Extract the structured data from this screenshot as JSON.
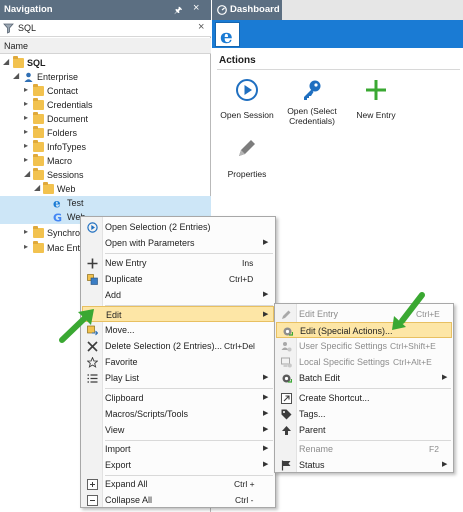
{
  "navigation": {
    "title": "Navigation",
    "search_value": "SQL",
    "column_header": "Name",
    "tree": [
      {
        "label": "SQL",
        "bold": true
      },
      {
        "label": "Enterprise"
      },
      {
        "label": "Contact"
      },
      {
        "label": "Credentials"
      },
      {
        "label": "Document"
      },
      {
        "label": "Folders"
      },
      {
        "label": "InfoTypes"
      },
      {
        "label": "Macro"
      },
      {
        "label": "Sessions"
      },
      {
        "label": "Web"
      },
      {
        "label": "Test"
      },
      {
        "label": "Web"
      },
      {
        "label": "Synchroni"
      },
      {
        "label": "Mac Entrie"
      }
    ]
  },
  "dashboard": {
    "tab_label": "Dashboard",
    "actions_title": "Actions",
    "actions": [
      {
        "label": "Open Session",
        "icon": "play-circle-icon"
      },
      {
        "label": "Open (Select\nCredentials)",
        "icon": "key-icon"
      },
      {
        "label": "New Entry",
        "icon": "plus-icon"
      },
      {
        "label": "Properties",
        "icon": "pencil-icon"
      }
    ]
  },
  "context_menu": {
    "items": [
      {
        "label": "Open Selection (2 Entries)",
        "icon": "play-circle-icon"
      },
      {
        "label": "Open with Parameters",
        "submenu": true
      },
      {
        "label": "New Entry",
        "shortcut": "Ins",
        "icon": "plus-icon"
      },
      {
        "label": "Duplicate",
        "shortcut": "Ctrl+D",
        "icon": "duplicate-icon"
      },
      {
        "label": "Add",
        "submenu": true
      },
      {
        "label": "Edit",
        "submenu": true,
        "highlighted": true
      },
      {
        "label": "Move...",
        "icon": "move-icon"
      },
      {
        "label": "Delete Selection (2 Entries)...",
        "shortcut": "Ctrl+Del",
        "icon": "delete-icon"
      },
      {
        "label": "Favorite",
        "icon": "star-icon"
      },
      {
        "label": "Play List",
        "submenu": true,
        "icon": "list-icon"
      },
      {
        "label": "Clipboard",
        "submenu": true
      },
      {
        "label": "Macros/Scripts/Tools",
        "submenu": true
      },
      {
        "label": "View",
        "submenu": true
      },
      {
        "label": "Import",
        "submenu": true
      },
      {
        "label": "Export",
        "submenu": true
      },
      {
        "label": "Expand All",
        "shortcut": "Ctrl +",
        "icon": "expand-icon"
      },
      {
        "label": "Collapse All",
        "shortcut": "Ctrl -",
        "icon": "collapse-icon"
      }
    ]
  },
  "edit_submenu": {
    "items": [
      {
        "label": "Edit Entry",
        "shortcut": "Ctrl+E",
        "disabled": true
      },
      {
        "label": "Edit (Special Actions)...",
        "highlighted": true
      },
      {
        "label": "User Specific Settings",
        "shortcut": "Ctrl+Shift+E",
        "disabled": true
      },
      {
        "label": "Local Specific Settings",
        "shortcut": "Ctrl+Alt+E",
        "disabled": true
      },
      {
        "label": "Batch Edit",
        "submenu": true
      },
      {
        "label": "Create Shortcut..."
      },
      {
        "label": "Tags..."
      },
      {
        "label": "Parent"
      },
      {
        "label": "Rename",
        "shortcut": "F2",
        "disabled": true
      },
      {
        "label": "Status",
        "submenu": true
      }
    ]
  },
  "colors": {
    "header_bg": "#5c6f82",
    "dashboard_band": "#1a7bd4",
    "highlight": "#fde6a6",
    "arrow_green": "#3aa832"
  }
}
